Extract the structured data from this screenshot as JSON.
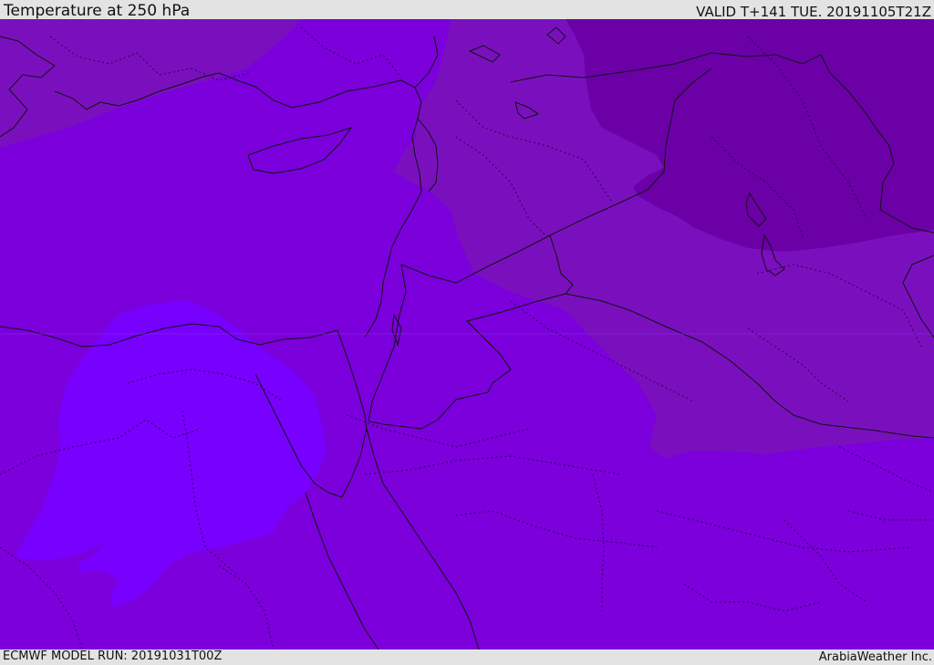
{
  "header": {
    "title": "Temperature at 250 hPa",
    "valid": "VALID T+141 TUE. 20191105T21Z"
  },
  "footer": {
    "model_run": "ECMWF MODEL RUN: 20191031T00Z",
    "credit": "ArabiaWeather Inc."
  },
  "map": {
    "colors": {
      "base": "#7b00dc",
      "warm_band": "#7a10bd",
      "cold_core": "#6a00a6",
      "bright_patch": "#7800ff",
      "border": "#111111"
    }
  }
}
